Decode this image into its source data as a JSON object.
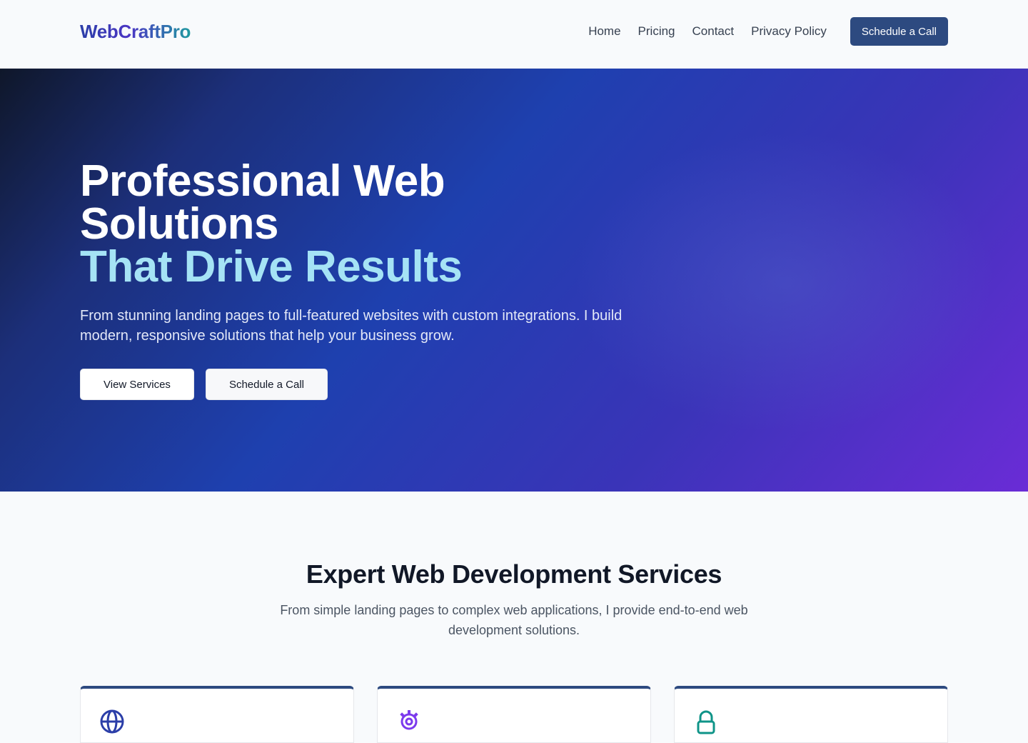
{
  "header": {
    "logo": "WebCraftPro",
    "nav": [
      {
        "label": "Home"
      },
      {
        "label": "Pricing"
      },
      {
        "label": "Contact"
      },
      {
        "label": "Privacy Policy"
      }
    ],
    "cta_label": "Schedule a Call"
  },
  "hero": {
    "title_line1": "Professional Web",
    "title_line2": "Solutions",
    "title_accent": "That Drive Results",
    "subtitle": "From stunning landing pages to full-featured websites with custom integrations. I build modern, responsive solutions that help your business grow.",
    "primary_button": "View Services",
    "secondary_button": "Schedule a Call"
  },
  "services": {
    "title": "Expert Web Development Services",
    "subtitle": "From simple landing pages to complex web applications, I provide end-to-end web development solutions.",
    "cards": [
      {
        "icon": "globe-icon",
        "color": "#2b3ea8"
      },
      {
        "icon": "gear-icon",
        "color": "#7c3aed"
      },
      {
        "icon": "lock-icon",
        "color": "#0f9488"
      }
    ]
  },
  "colors": {
    "brand_dark": "#2d4a80",
    "hero_accent_text": "#a5e3f5"
  }
}
